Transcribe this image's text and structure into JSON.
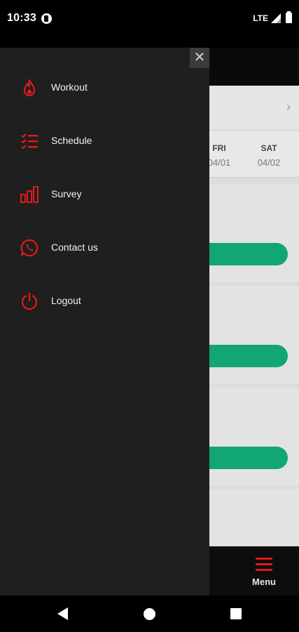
{
  "status_bar": {
    "time": "10:33",
    "network": "LTE",
    "icons": [
      "app-notification-icon",
      "signal-icon",
      "battery-icon"
    ]
  },
  "drawer": {
    "close_label": "✕",
    "items": [
      {
        "label": "Workout",
        "icon": "flame-icon"
      },
      {
        "label": "Schedule",
        "icon": "checklist-icon"
      },
      {
        "label": "Survey",
        "icon": "bar-chart-icon"
      },
      {
        "label": "Contact us",
        "icon": "whatsapp-icon"
      },
      {
        "label": "Logout",
        "icon": "power-icon"
      }
    ]
  },
  "schedule": {
    "next_week_label": "›",
    "days": [
      {
        "name": "FRI",
        "date": "04/01"
      },
      {
        "name": "SAT",
        "date": "04/02"
      }
    ]
  },
  "bottom_bar": {
    "menu_label": "Menu"
  },
  "colors": {
    "accent_red": "#e01a1a",
    "action_green": "#12a672",
    "drawer_bg": "#1f1f1f"
  }
}
